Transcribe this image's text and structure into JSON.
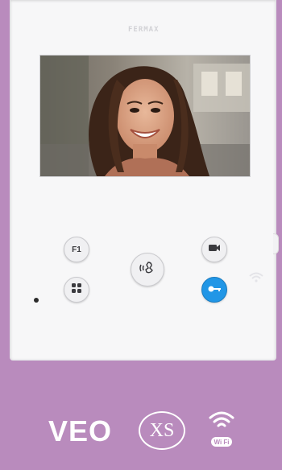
{
  "device": {
    "brand": "FERMAX"
  },
  "screen": {
    "content": "visitor video feed"
  },
  "buttons": {
    "f1_label": "F1",
    "menu_icon": "grid-icon",
    "talk_icon": "talk-icon",
    "camera_icon": "camera-icon",
    "door_icon": "key-icon"
  },
  "logo": {
    "veo": "VEO",
    "xs": "XS",
    "wifi_badge": "Wi Fi"
  },
  "colors": {
    "background": "#b98bbd",
    "door_button": "#2196e6"
  }
}
